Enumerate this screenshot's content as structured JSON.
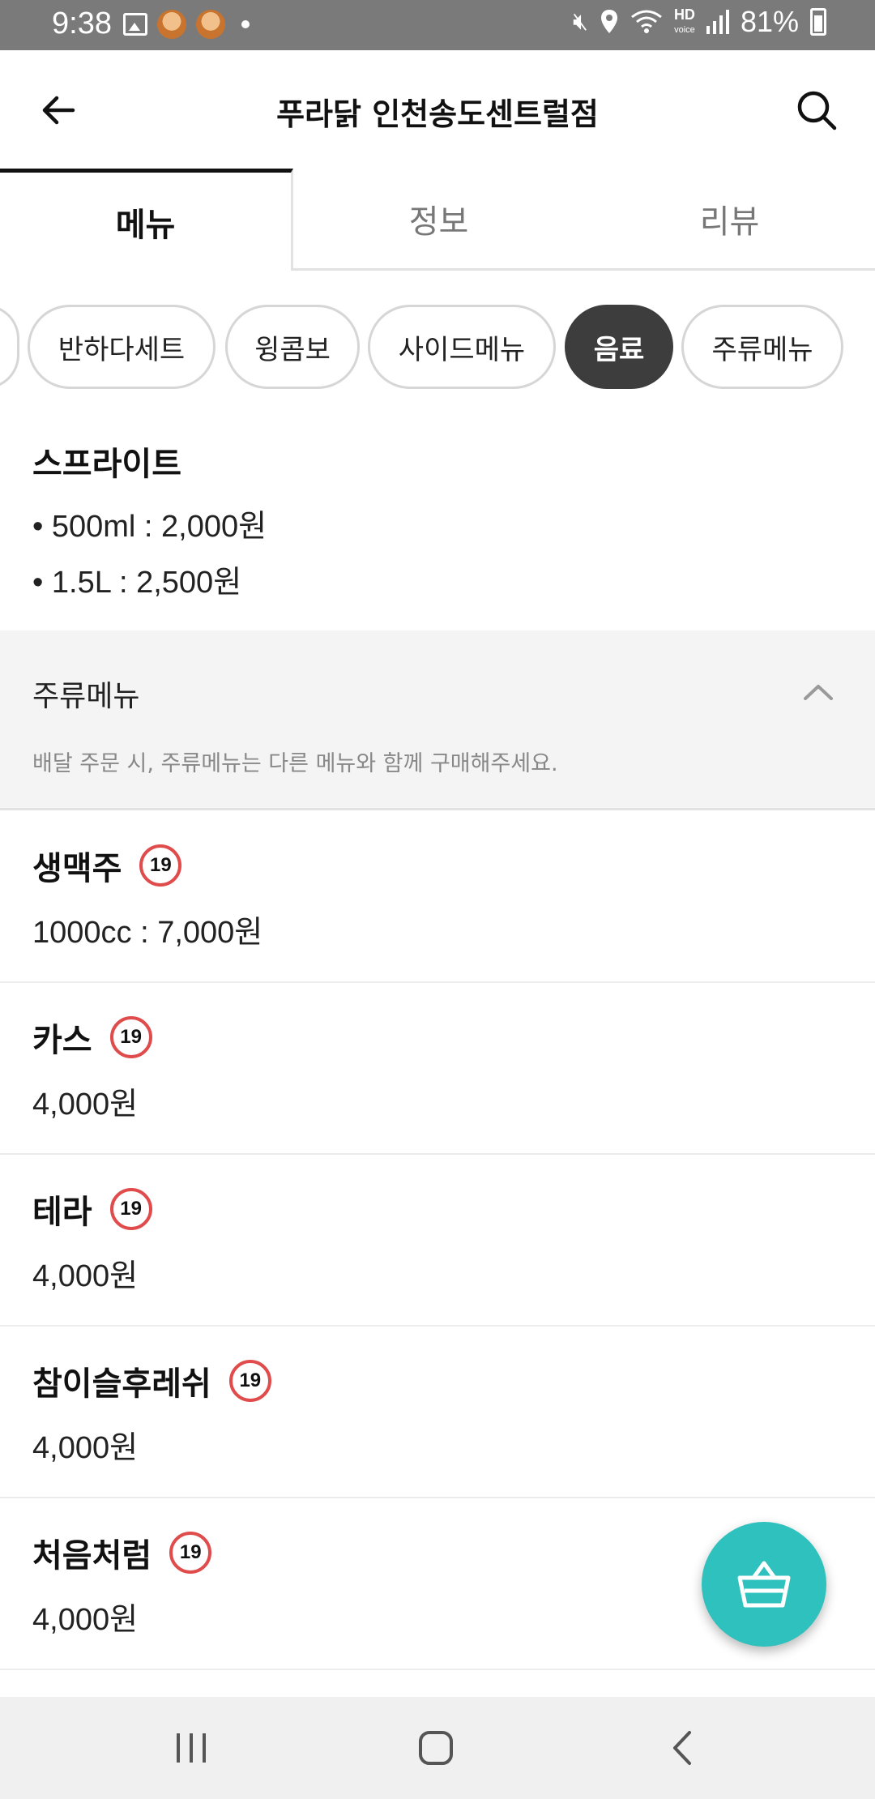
{
  "status_bar": {
    "time": "9:38",
    "hd_top": "HD",
    "hd_bottom": "voice",
    "battery": "81%",
    "icons": [
      "photo-icon",
      "avatar-icon",
      "avatar-icon",
      "dot-icon",
      "mute-icon",
      "location-icon",
      "wifi-icon",
      "signal-icon",
      "battery-charging-icon"
    ]
  },
  "header": {
    "title": "푸라닭 인천송도센트럴점",
    "back_icon": "arrow-left-icon",
    "search_icon": "search-icon"
  },
  "tabs": [
    {
      "label": "메뉴",
      "active": true
    },
    {
      "label": "정보",
      "active": false
    },
    {
      "label": "리뷰",
      "active": false
    }
  ],
  "categories": [
    {
      "label": "반하다세트",
      "active": false
    },
    {
      "label": "윙콤보",
      "active": false
    },
    {
      "label": "사이드메뉴",
      "active": false
    },
    {
      "label": "음료",
      "active": true
    },
    {
      "label": "주류메뉴",
      "active": false
    }
  ],
  "sprite": {
    "name": "스프라이트",
    "options": [
      "500ml : 2,000원",
      "1.5L : 2,500원"
    ]
  },
  "section": {
    "title": "주류메뉴",
    "notice": "배달 주문 시, 주류메뉴는 다른 메뉴와 함께 구매해주세요.",
    "expanded": true
  },
  "age_badge": "19",
  "items": [
    {
      "name": "생맥주",
      "price": "1000cc : 7,000원"
    },
    {
      "name": "카스",
      "price": "4,000원"
    },
    {
      "name": "테라",
      "price": "4,000원"
    },
    {
      "name": "참이슬후레쉬",
      "price": "4,000원"
    },
    {
      "name": "처음처럼",
      "price": "4,000원"
    }
  ],
  "fab_icon": "basket-icon",
  "colors": {
    "accent": "#2fc1bd",
    "chip_active": "#3d3d3d",
    "age_badge": "#e04b4b",
    "section_bg": "#f4f4f4"
  }
}
